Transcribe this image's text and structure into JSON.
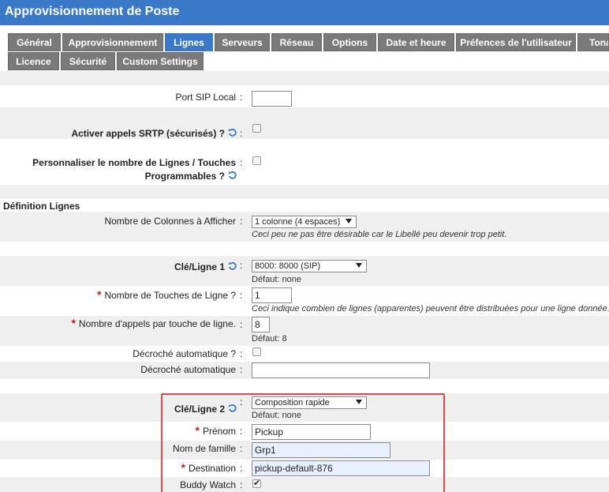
{
  "header": {
    "title": "Approvisionnement de Poste"
  },
  "tabs": {
    "row1": [
      "Général",
      "Approvisionnement",
      "Lignes",
      "Serveurs",
      "Réseau",
      "Options",
      "Date et heure",
      "Préfences de l'utilisateur",
      "Tonal"
    ],
    "row2": [
      "Licence",
      "Sécurité",
      "Custom Settings"
    ],
    "active": "Lignes"
  },
  "fields": {
    "port_sip_local": {
      "label": "Port SIP Local",
      "value": ""
    },
    "srtp": {
      "label": "Activer appels SRTP (sécurisés) ?",
      "checked": false
    },
    "personnaliser": {
      "label_line1": "Personnaliser le nombre de Lignes / Touches",
      "label_line2": "Programmables ?",
      "checked": false
    },
    "section": "Définition Lignes",
    "colonnes": {
      "label": "Nombre de Colonnes à Afficher",
      "value": "1 colonne (4 espaces)",
      "hint": "Ceci peu ne pas être désirable car le Libellé peu devenir trop petit."
    },
    "cle1": {
      "label": "Clé/Ligne 1",
      "value": "8000: 8000 (SIP)",
      "default": "Défaut: none"
    },
    "touches_ligne": {
      "label": "Nombre de Touches de Ligne ?",
      "value": "1",
      "hint": "Ceci indique combien de lignes (apparentes) peuvent être distribuées pour une ligne donnée."
    },
    "appels_touche": {
      "label": "Nombre d'appels par touche de ligne.",
      "value": "8",
      "default": "Défaut: 8"
    },
    "decroche_check": {
      "label": "Décroché automatique ?",
      "checked": false
    },
    "decroche_text": {
      "label": "Décroché automatique",
      "value": ""
    },
    "cle2": {
      "label": "Clé/Ligne 2",
      "value": "Composition rapide",
      "default": "Défaut: none"
    },
    "prenom": {
      "label": "Prénom",
      "value": "Pickup"
    },
    "nom_famille": {
      "label": "Nom de famille",
      "value": "Grp1"
    },
    "destination": {
      "label": "Destination",
      "value": "pickup-default-876"
    },
    "buddy_watch": {
      "label": "Buddy Watch",
      "checked": true
    }
  },
  "colors": {
    "header_blue": "#3a78c8",
    "tab_gray": "#7a7a7a",
    "required_red": "#c0201f",
    "highlight_red": "#e0474c"
  },
  "icons": {
    "refresh": "refresh-icon",
    "required": "required-asterisk-icon"
  }
}
